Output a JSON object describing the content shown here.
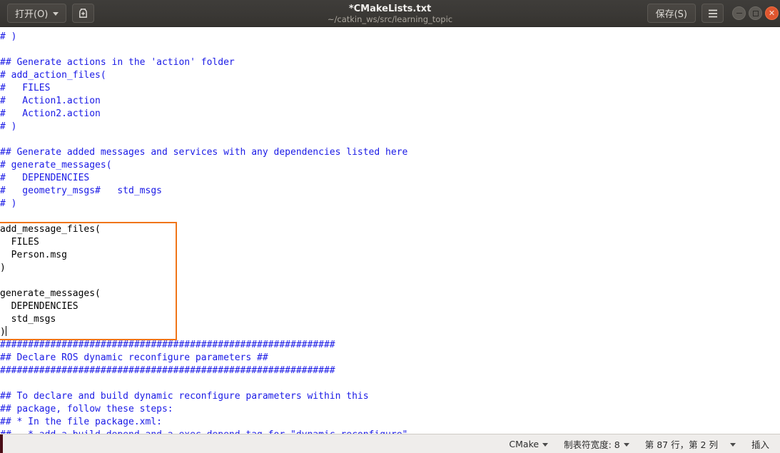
{
  "titlebar": {
    "open_label": "打开(O)",
    "new_window_icon": "new-document-icon",
    "title": "*CMakeLists.txt",
    "subtitle": "~/catkin_ws/src/learning_topic",
    "save_label": "保存(S)",
    "menu_icon": "hamburger-menu-icon",
    "minimize_icon": "minimize-icon",
    "maximize_icon": "maximize-icon",
    "close_icon": "close-icon"
  },
  "editor": {
    "comment_color": "#1a1ae6",
    "text_color": "#000000",
    "highlight_border_color": "#f07518",
    "lines": [
      {
        "text": "# )",
        "type": "comment"
      },
      {
        "text": "",
        "type": "blank"
      },
      {
        "text": "## Generate actions in the 'action' folder",
        "type": "comment"
      },
      {
        "text": "# add_action_files(",
        "type": "comment"
      },
      {
        "text": "#   FILES",
        "type": "comment"
      },
      {
        "text": "#   Action1.action",
        "type": "comment"
      },
      {
        "text": "#   Action2.action",
        "type": "comment"
      },
      {
        "text": "# )",
        "type": "comment"
      },
      {
        "text": "",
        "type": "blank"
      },
      {
        "text": "## Generate added messages and services with any dependencies listed here",
        "type": "comment"
      },
      {
        "text": "# generate_messages(",
        "type": "comment"
      },
      {
        "text": "#   DEPENDENCIES",
        "type": "comment"
      },
      {
        "text": "#   geometry_msgs#   std_msgs",
        "type": "comment"
      },
      {
        "text": "# )",
        "type": "comment"
      },
      {
        "text": "",
        "type": "blank"
      },
      {
        "text": "add_message_files(",
        "type": "code"
      },
      {
        "text": "  FILES",
        "type": "code"
      },
      {
        "text": "  Person.msg",
        "type": "code"
      },
      {
        "text": ")",
        "type": "code"
      },
      {
        "text": "",
        "type": "blank"
      },
      {
        "text": "generate_messages(",
        "type": "code"
      },
      {
        "text": "  DEPENDENCIES",
        "type": "code"
      },
      {
        "text": "  std_msgs",
        "type": "code"
      },
      {
        "text": ")",
        "type": "code",
        "cursor": true
      },
      {
        "text": "############################################################",
        "type": "comment"
      },
      {
        "text": "## Declare ROS dynamic reconfigure parameters ##",
        "type": "comment"
      },
      {
        "text": "############################################################",
        "type": "comment"
      },
      {
        "text": "",
        "type": "blank"
      },
      {
        "text": "## To declare and build dynamic reconfigure parameters within this",
        "type": "comment"
      },
      {
        "text": "## package, follow these steps:",
        "type": "comment"
      },
      {
        "text": "## * In the file package.xml:",
        "type": "comment"
      },
      {
        "text": "##   * add a build_depend and a exec_depend tag for \"dynamic_reconfigure\"",
        "type": "comment"
      }
    ]
  },
  "statusbar": {
    "language": "CMake",
    "tab_width": "制表符宽度: 8",
    "position": "第 87 行，第 2 列",
    "mode": "插入"
  }
}
